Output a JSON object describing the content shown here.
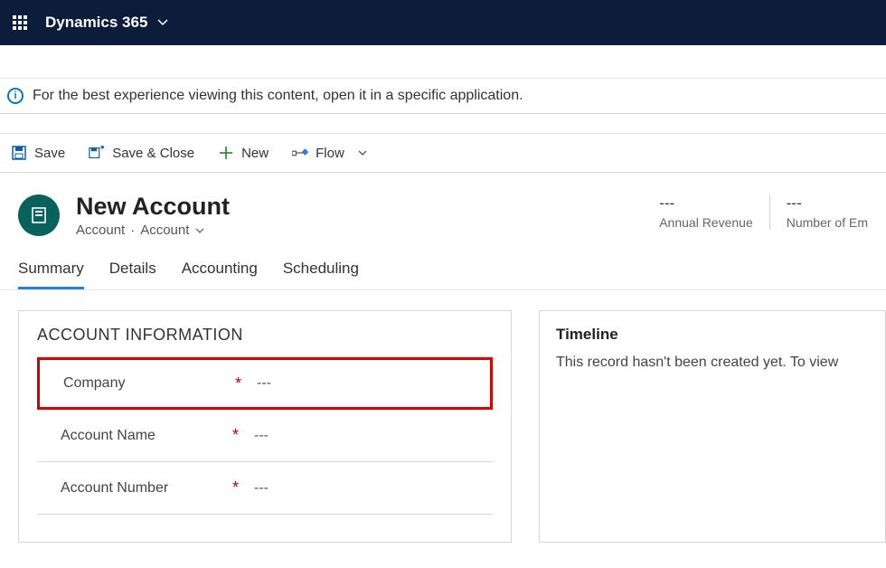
{
  "topbar": {
    "brand": "Dynamics 365"
  },
  "info_bar": {
    "message": "For the best experience viewing this content, open it in a specific application."
  },
  "cmdbar": {
    "save": "Save",
    "save_close": "Save & Close",
    "new": "New",
    "flow": "Flow"
  },
  "record": {
    "title": "New Account",
    "breadcrumb_a": "Account",
    "breadcrumb_b": "Account",
    "stats": [
      {
        "value": "---",
        "label": "Annual Revenue"
      },
      {
        "value": "---",
        "label": "Number of Em"
      }
    ]
  },
  "tabs": [
    "Summary",
    "Details",
    "Accounting",
    "Scheduling"
  ],
  "section": {
    "title": "ACCOUNT INFORMATION",
    "fields": [
      {
        "label": "Company",
        "required": "*",
        "value": "---"
      },
      {
        "label": "Account Name",
        "required": "*",
        "value": "---"
      },
      {
        "label": "Account Number",
        "required": "*",
        "value": "---"
      }
    ]
  },
  "timeline": {
    "title": "Timeline",
    "message": "This record hasn't been created yet.  To view"
  }
}
